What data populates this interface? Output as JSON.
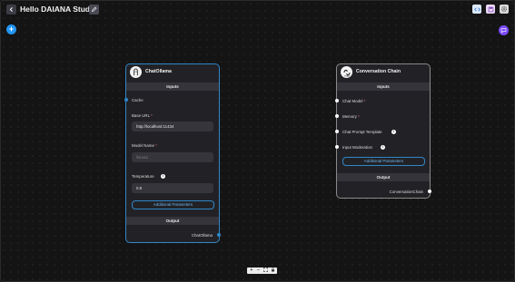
{
  "header": {
    "title": "Hello DAIANA Studio"
  },
  "colors": {
    "accent": "#2196f3",
    "selected_border": "#2f87c8",
    "chat_button": "#7c4dff"
  },
  "nodes": {
    "chat_ollama": {
      "title": "ChatOllama",
      "inputs_label": "Inputs",
      "cache_label": "Cache",
      "base_url_label": "Base URL",
      "base_url_value": "http://localhost:11434",
      "model_name_label": "Model Name",
      "model_name_placeholder": "llama2",
      "temperature_label": "Temperature",
      "temperature_value": "0.9",
      "additional_params_label": "Additional Parameters",
      "output_label": "Output",
      "output_item": "ChatOllama",
      "required_marker": "*"
    },
    "conversation_chain": {
      "title": "Conversation Chain",
      "inputs_label": "Inputs",
      "chat_model_label": "Chat Model",
      "memory_label": "Memory",
      "chat_prompt_label": "Chat Prompt Template",
      "input_moderation_label": "Input Moderation",
      "additional_params_label": "Additional Parameters",
      "output_label": "Output",
      "output_item": "ConversationChain",
      "required_marker": "*"
    }
  },
  "zoom_controls": {
    "zoom_in": "+",
    "zoom_out": "−",
    "fit_view": "⛶",
    "lock": "🔒"
  },
  "icons": {
    "back": "chevron-left-icon",
    "edit": "pencil-icon",
    "code": "code-icon",
    "settings": "gear-icon",
    "save": "save-icon",
    "add": "plus-icon",
    "chat": "chat-icon"
  }
}
